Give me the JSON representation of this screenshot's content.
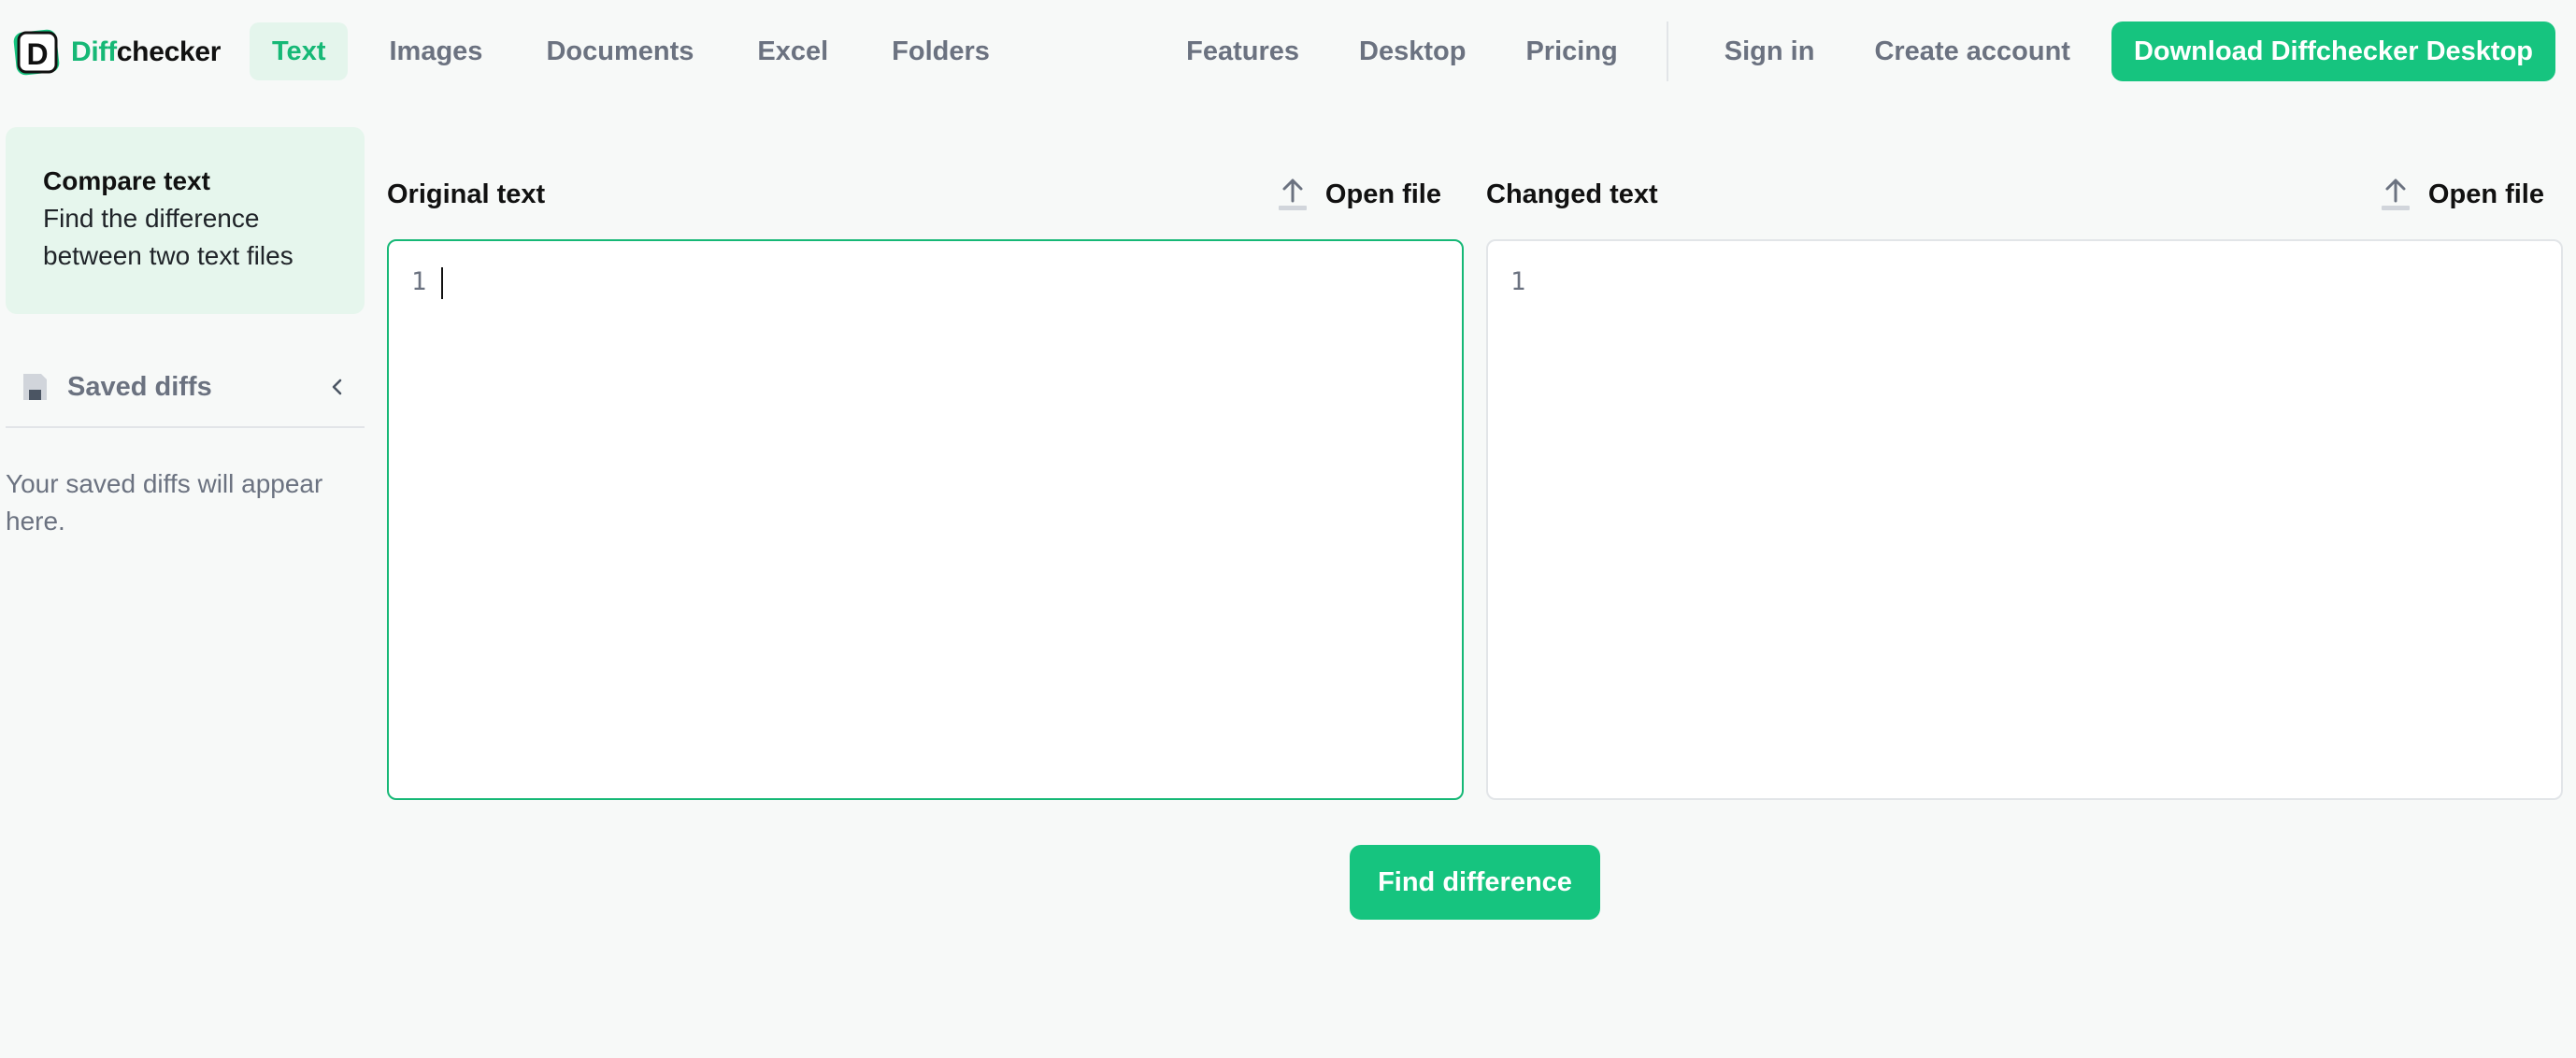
{
  "logo": {
    "mark": "D",
    "text_accent": "Diff",
    "text_rest": "checker"
  },
  "nav": {
    "left": [
      "Text",
      "Images",
      "Documents",
      "Excel",
      "Folders"
    ],
    "active_index": 0,
    "right": [
      "Features",
      "Desktop",
      "Pricing"
    ],
    "sign_in": "Sign in",
    "create_account": "Create account",
    "download": "Download Diffchecker Desktop"
  },
  "sidebar": {
    "compare_title": "Compare text",
    "compare_desc": "Find the difference between two text files",
    "saved_label": "Saved diffs",
    "saved_empty": "Your saved diffs will appear here."
  },
  "original": {
    "title": "Original text",
    "open_file": "Open file",
    "line_number": "1",
    "value": "",
    "placeholder": ""
  },
  "changed": {
    "title": "Changed text",
    "open_file": "Open file",
    "line_number": "1",
    "value": "",
    "placeholder": ""
  },
  "actions": {
    "find_difference": "Find difference"
  },
  "colors": {
    "accent": "#16c47f",
    "accent_text": "#16b876",
    "active_bg": "#e4f5ec",
    "muted": "#6b7280",
    "background": "#f7f9f8"
  },
  "icons": {
    "logo": "diffchecker-logo-icon",
    "upload": "upload-icon",
    "saved": "floppy-disk-icon",
    "collapse": "chevron-left-icon"
  }
}
